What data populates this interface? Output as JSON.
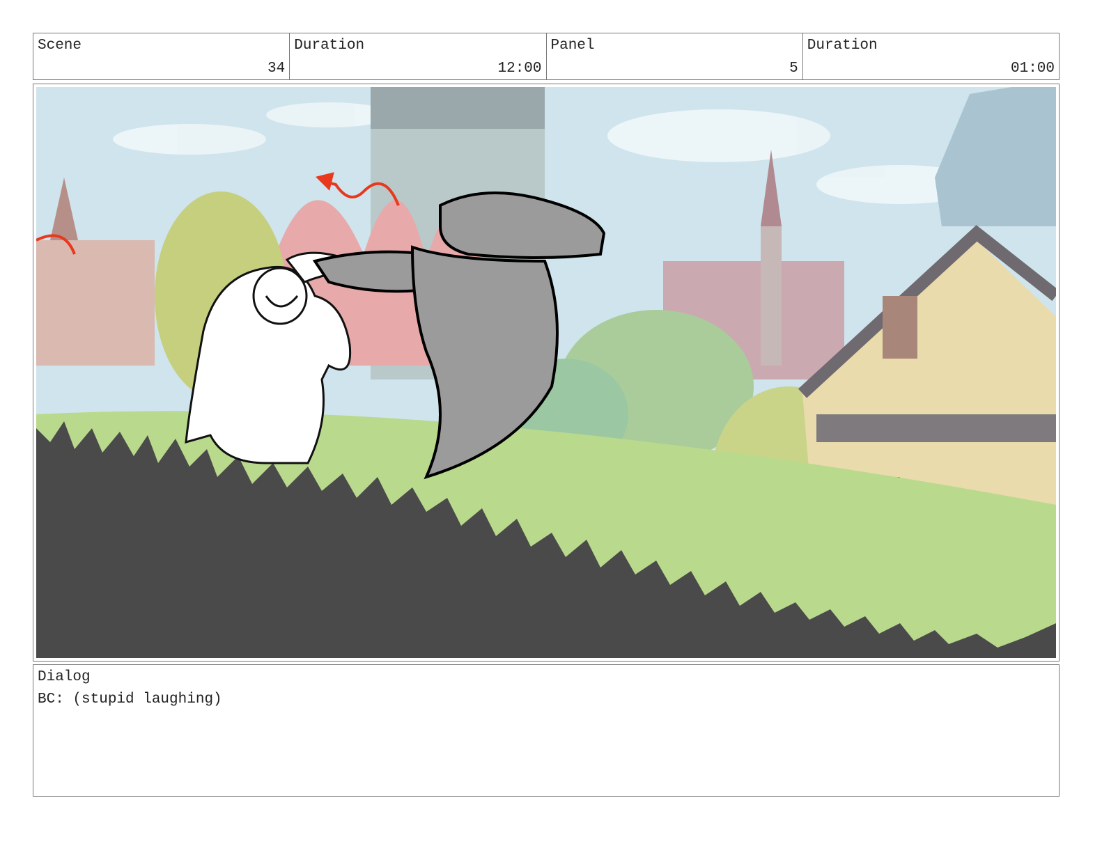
{
  "header": {
    "scene": {
      "label": "Scene",
      "value": "34"
    },
    "scene_duration": {
      "label": "Duration",
      "value": "12:00"
    },
    "panel": {
      "label": "Panel",
      "value": "5"
    },
    "panel_duration": {
      "label": "Duration",
      "value": "01:00"
    }
  },
  "dialog": {
    "label": "Dialog",
    "text": "BC: (stupid laughing)"
  },
  "colors": {
    "sky": "#c9e1ea",
    "grass": "#b7d98a",
    "foreground": "#4a4a4a",
    "arrow": "#e8381e"
  }
}
